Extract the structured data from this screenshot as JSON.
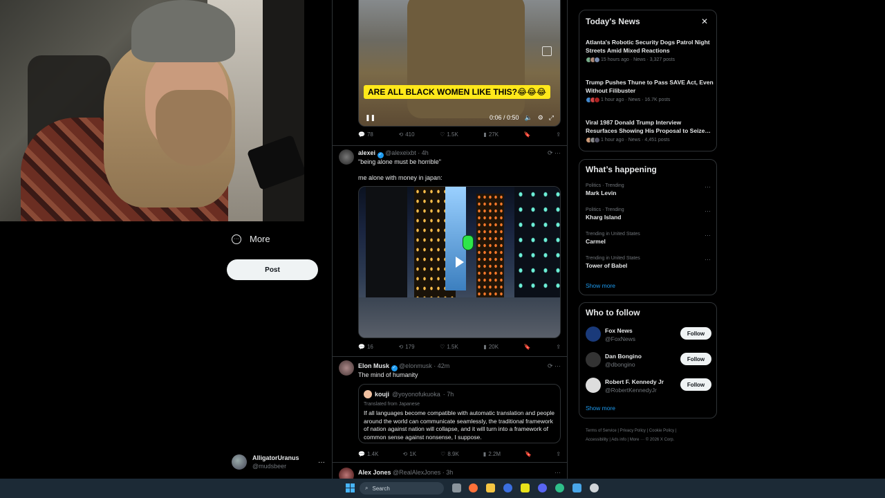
{
  "left_nav": {
    "more_label": "More",
    "post_label": "Post",
    "account": {
      "name": "AlligatorUranus",
      "handle": "@mudsbeer"
    }
  },
  "timeline": {
    "post1": {
      "caption": "ARE ALL BLACK WOMEN LIKE THIS?😂😂😂",
      "time": "0:06 / 0:50",
      "actions": {
        "replies": "78",
        "reposts": "410",
        "likes": "1.5K",
        "views": "27K"
      }
    },
    "post2": {
      "name": "alexei",
      "handle": "@alexeixbt",
      "age": "· 4h",
      "text1": "\"being alone must be horrible\"",
      "text2": "me alone with money in japan:",
      "actions": {
        "replies": "16",
        "reposts": "179",
        "likes": "1.5K",
        "views": "20K"
      }
    },
    "post3": {
      "name": "Elon Musk",
      "handle": "@elonmusk",
      "age": "· 42m",
      "text": "The mind of humanity",
      "quote": {
        "name": "kouji",
        "handle": "@yoyonofukuoka",
        "age": "· 7h",
        "translated": "Translated from Japanese",
        "text": "If all languages become compatible with automatic translation and people around the world can communicate seamlessly, the traditional framework of nation against nation will collapse, and it will turn into a framework of common sense against nonsense, I suppose."
      },
      "actions": {
        "replies": "1.4K",
        "reposts": "1K",
        "likes": "8.9K",
        "views": "2.2M"
      }
    },
    "post4": {
      "name": "Alex Jones",
      "handle": "@RealAlexJones",
      "age": "· 3h"
    }
  },
  "sidebar": {
    "todays_news": {
      "title": "Today's News",
      "items": [
        {
          "headline": "Atlanta's Robotic Security Dogs Patrol Night Streets Amid Mixed Reactions",
          "meta": "15 hours ago · News · 3,327 posts"
        },
        {
          "headline": "Trump Pushes Thune to Pass SAVE Act, Even Without Filibuster",
          "meta": "1 hour ago · News · 16.7K posts"
        },
        {
          "headline": "Viral 1987 Donald Trump Interview Resurfaces Showing His Proposal to Seize…",
          "meta": "1 hour ago · News · 4,451 posts"
        }
      ]
    },
    "whats_happening": {
      "title": "What’s happening",
      "items": [
        {
          "category": "Politics · Trending",
          "name": "Mark Levin"
        },
        {
          "category": "Politics · Trending",
          "name": "Kharg Island"
        },
        {
          "category": "Trending in United States",
          "name": "Carmel"
        },
        {
          "category": "Trending in United States",
          "name": "Tower of Babel"
        }
      ],
      "show_more": "Show more"
    },
    "who_to_follow": {
      "title": "Who to follow",
      "items": [
        {
          "name": "Fox News",
          "handle": "@FoxNews",
          "button": "Follow"
        },
        {
          "name": "Dan Bongino",
          "handle": "@dbongino",
          "button": "Follow"
        },
        {
          "name": "Robert F. Kennedy Jr",
          "handle": "@RobertKennedyJr",
          "button": "Follow"
        }
      ],
      "show_more": "Show more"
    },
    "footer": {
      "line1": "Terms of Service  |  Privacy Policy  |  Cookie Policy  |",
      "line2": "Accessibility  |  Ads info  |  More ···  © 2026 X Corp."
    }
  },
  "taskbar": {
    "search_label": "Search"
  },
  "colors": {
    "accent": "#1d9bf0",
    "caption_bg": "#ffe81a",
    "background": "#000000",
    "border": "#2f3336"
  }
}
